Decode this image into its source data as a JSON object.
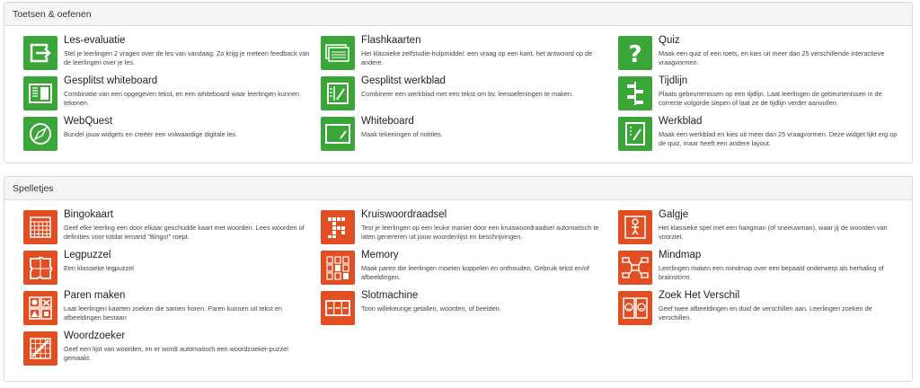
{
  "sections": [
    {
      "title": "Toetsen & oefenen",
      "items": [
        {
          "title": "Les-evaluatie",
          "desc": "Stel je leerlingen 2 vragen over de les van vandaag. Zo krijg je meteen feedback van de leerlingen over je les.",
          "icon": "exit-icon"
        },
        {
          "title": "Flashkaarten",
          "desc": "Het klassieke zelfstudie-hulpmiddel: een vraag op een kant, het antwoord op de andere.",
          "icon": "flashcards-icon"
        },
        {
          "title": "Quiz",
          "desc": "Maak een quiz of een toets, en kies uit meer dan 25 verschillende interactieve vraagvormen.",
          "icon": "question-icon"
        },
        {
          "title": "Gesplitst whiteboard",
          "desc": "Combinatie van een opgegeven tekst, en een whiteboard waar leerlingen kunnen tekenen.",
          "icon": "split-whiteboard-icon"
        },
        {
          "title": "Gesplitst werkblad",
          "desc": "Combineer een werkblad met een tekst om bv. leesoefeningen te maken.",
          "icon": "split-worksheet-icon"
        },
        {
          "title": "Tijdlijn",
          "desc": "Plaats gebeurtenissen op een tijdlijn. Laat leerlingen de gebeurtenissen in de correcte volgorde slepen of laat ze de tijdlijn verder aanvullen.",
          "icon": "timeline-icon"
        },
        {
          "title": "WebQuest",
          "desc": "Bundel jouw widgets en creëer een volwaardige digitale les.",
          "icon": "compass-icon"
        },
        {
          "title": "Whiteboard",
          "desc": "Maak tekeningen of notities.",
          "icon": "whiteboard-icon"
        },
        {
          "title": "Werkblad",
          "desc": "Maak een werkblad en kies uit meer dan 25 vraagvormen. Deze widget lijkt erg op de quiz, maar heeft een andere layout.",
          "icon": "worksheet-icon"
        }
      ]
    },
    {
      "title": "Spelletjes",
      "items": [
        {
          "title": "Bingokaart",
          "desc": "Geef elke leerling een door elkaar geschudde kaart met woorden. Lees woorden of definities voor totdat iemand \"Bingo!\" roept.",
          "icon": "bingo-card-icon"
        },
        {
          "title": "Kruiswoordraadsel",
          "desc": "Test je leerlingen op een leuke manier door een kruiswoordraadsel automatisch te laten genereren uit jouw woordenlijst en beschrijvingen.",
          "icon": "crossword-icon"
        },
        {
          "title": "Galgje",
          "desc": "Het klassieke spel met een hangman (of sneeuwman), waar jij de woorden van voorziet.",
          "icon": "hangman-icon"
        },
        {
          "title": "Legpuzzel",
          "desc": "Een klassieke legpuzzel",
          "icon": "puzzle-icon"
        },
        {
          "title": "Memory",
          "desc": "Maak paren die leerlingen moeten koppelen en onthouden. Gebruik tekst en/of afbeeldingen.",
          "icon": "memory-icon"
        },
        {
          "title": "Mindmap",
          "desc": "Leerlingen maken een mindmap over een bepaald onderwerp als herhaling of brainstorm.",
          "icon": "mindmap-icon"
        },
        {
          "title": "Paren maken",
          "desc": "Laat leerlingen kaarten zoeken die samen horen. Paren kunnen uit tekst en afbeeldingen bestaan",
          "icon": "pairs-icon"
        },
        {
          "title": "Slotmachine",
          "desc": "Toon willekeurige getallen, woorden, of beelden.",
          "icon": "slot-machine-icon"
        },
        {
          "title": "Zoek Het Verschil",
          "desc": "Geef twee afbeeldingen en duid de verschillen aan. Leerlingen zoeken de verschillen.",
          "icon": "spot-difference-icon"
        },
        {
          "title": "Woordzoeker",
          "desc": "Geef een lijst van woorden, en er wordt automatisch een woordzoeker-puzzel gemaakt.",
          "icon": "word-search-icon"
        }
      ]
    }
  ],
  "colors": {
    "green": "#3aa63a",
    "orange": "#e04e22"
  }
}
